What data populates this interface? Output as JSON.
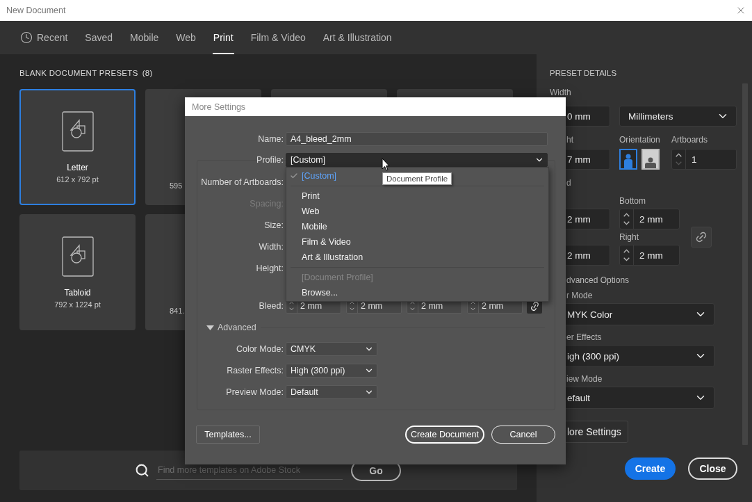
{
  "window": {
    "title": "New Document"
  },
  "tabs": [
    {
      "label": "Recent",
      "kind": "recent",
      "selected": false
    },
    {
      "label": "Saved",
      "kind": "plain",
      "selected": false
    },
    {
      "label": "Mobile",
      "kind": "plain",
      "selected": false
    },
    {
      "label": "Web",
      "kind": "plain",
      "selected": false
    },
    {
      "label": "Print",
      "kind": "plain",
      "selected": true
    },
    {
      "label": "Film & Video",
      "kind": "plain",
      "selected": false
    },
    {
      "label": "Art & Illustration",
      "kind": "plain",
      "selected": false
    }
  ],
  "presets": {
    "heading": "BLANK DOCUMENT PRESETS",
    "count": "(8)",
    "cards": [
      {
        "kind": "full",
        "name": "Letter",
        "size": "612 x 792 pt",
        "selected": true
      },
      {
        "kind": "partial",
        "size": "595",
        "selected": false
      },
      {
        "kind": "blank",
        "selected": false
      },
      {
        "kind": "blank",
        "selected": false
      },
      {
        "kind": "full",
        "name": "Tabloid",
        "size": "792 x 1224 pt",
        "selected": false
      },
      {
        "kind": "partial",
        "size": "841.",
        "selected": false
      }
    ]
  },
  "search": {
    "placeholder": "Find more templates on Adobe Stock",
    "button": "Go"
  },
  "details": {
    "heading": "PRESET DETAILS",
    "width": {
      "label": "Width",
      "value": "0 mm"
    },
    "units": "Millimeters",
    "height": {
      "label": "ht",
      "value": "7 mm"
    },
    "orientation": {
      "label": "Orientation",
      "options": [
        {
          "kind": "portrait",
          "selected": true
        },
        {
          "kind": "landscape",
          "selected": false
        }
      ]
    },
    "artboards": {
      "label": "Artboards",
      "value": "1"
    },
    "bleed": {
      "label": "d",
      "rows": [
        {
          "label": "Bottom",
          "left_value": "2 mm",
          "right_value": "2 mm"
        },
        {
          "label": "Right",
          "left_value": "2 mm",
          "right_value": "2 mm"
        }
      ]
    },
    "advanced_label": "dvanced Options",
    "selects": [
      {
        "label": "r Mode",
        "value": "MYK Color"
      },
      {
        "label": "er Effects",
        "value": "igh (300 ppi)"
      },
      {
        "label": "iew Mode",
        "value": "efault"
      }
    ],
    "more_settings": "lore Settings",
    "create": "Create",
    "close": "Close"
  },
  "dialog": {
    "title": "More Settings",
    "name_label": "Name:",
    "name_value": "A4_bleed_2mm",
    "profile_label": "Profile:",
    "profile_value": "[Custom]",
    "group_labels": [
      {
        "label": "Number of Artboards:",
        "disabled": false
      },
      {
        "label": "Spacing:",
        "disabled": true
      },
      {
        "label": "Size:",
        "disabled": false
      },
      {
        "label": "Width:",
        "disabled": false
      },
      {
        "label": "Height:",
        "disabled": false
      }
    ],
    "bleed_label": "Bleed:",
    "bleed_values": [
      "2 mm",
      "2 mm",
      "2 mm",
      "2 mm"
    ],
    "advanced": {
      "label": "Advanced",
      "expanded": true
    },
    "advanced_fields": [
      {
        "label": "Color Mode:",
        "value": "CMYK"
      },
      {
        "label": "Raster Effects:",
        "value": "High (300 ppi)"
      },
      {
        "label": "Preview Mode:",
        "value": "Default"
      }
    ],
    "templates_button": "Templates...",
    "create_button": "Create Document",
    "cancel_button": "Cancel",
    "profile_menu": {
      "items": [
        {
          "kind": "item",
          "label": "[Custom]",
          "selected": true,
          "disabled": false
        },
        {
          "kind": "separator"
        },
        {
          "kind": "item",
          "label": "Print",
          "selected": false,
          "disabled": false
        },
        {
          "kind": "item",
          "label": "Web",
          "selected": false,
          "disabled": false
        },
        {
          "kind": "item",
          "label": "Mobile",
          "selected": false,
          "disabled": false
        },
        {
          "kind": "item",
          "label": "Film & Video",
          "selected": false,
          "disabled": false
        },
        {
          "kind": "item",
          "label": "Art & Illustration",
          "selected": false,
          "disabled": false
        },
        {
          "kind": "separator"
        },
        {
          "kind": "item",
          "label": "[Document Profile]",
          "selected": false,
          "disabled": true
        },
        {
          "kind": "item",
          "label": "Browse...",
          "selected": false,
          "disabled": false
        }
      ]
    },
    "tooltip": "Document Profile"
  }
}
